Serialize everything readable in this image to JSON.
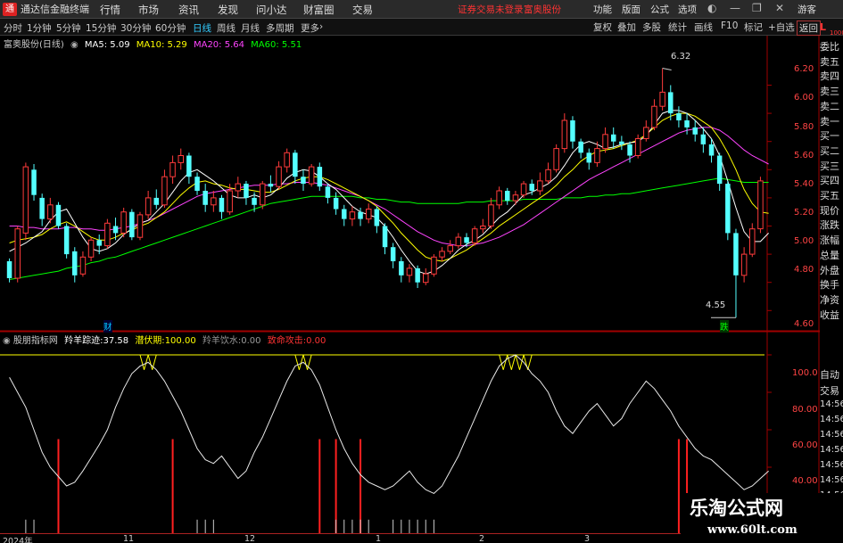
{
  "app": {
    "title": "通达信金融终端",
    "logo": "通"
  },
  "menus": [
    "行情",
    "市场",
    "资讯",
    "发现",
    "问小达",
    "财富圈",
    "交易"
  ],
  "notice": {
    "login": "证券交易未登录",
    "stock": "富奥股份"
  },
  "right_menus": [
    "功能",
    "版面",
    "公式",
    "选项"
  ],
  "guest": "游客",
  "periods": [
    "分时",
    "1分钟",
    "5分钟",
    "15分钟",
    "30分钟",
    "60分钟",
    "日线",
    "周线",
    "月线",
    "多周期",
    "更多"
  ],
  "active_period": "日线",
  "tools": [
    "复权",
    "叠加",
    "多股",
    "统计",
    "画线",
    "F10",
    "标记",
    "+自选",
    "返回"
  ],
  "stock_line": {
    "name": "富奥股份(日线)",
    "ma5": "MA5: 5.09",
    "ma10": "MA10: 5.29",
    "ma20": "MA20: 5.64",
    "ma60": "MA60: 5.51"
  },
  "price_axis": [
    "6.20",
    "6.00",
    "5.80",
    "5.60",
    "5.40",
    "5.20",
    "5.00",
    "4.80",
    "4.60"
  ],
  "high_label": "6.32",
  "low_label": "4.55",
  "marks": {
    "cai": "财",
    "die": "跌"
  },
  "indicator": {
    "name": "股朋指标网",
    "a_label": "羚羊踪迹:",
    "a_val": "37.58",
    "b_label": "潜伏期:",
    "b_val": "100.00",
    "c_label": "羚羊饮水:",
    "c_val": "0.00",
    "d_label": "致命攻击:",
    "d_val": "0.00"
  },
  "ind_axis": [
    "100.0",
    "80.00",
    "60.00",
    "40.00"
  ],
  "side_top": {
    "L": "L",
    "code": "1000"
  },
  "side_labels": [
    "委比",
    "卖五",
    "卖四",
    "卖三",
    "卖二",
    "卖一",
    "买一",
    "买二",
    "买三",
    "买四",
    "买五",
    "现价",
    "涨跌",
    "涨幅",
    "总量",
    "外盘",
    "换手",
    "净资",
    "收益"
  ],
  "side_lower": [
    "自动",
    "交易"
  ],
  "side_times": [
    "14:56",
    "14:56",
    "14:56",
    "14:56",
    "14:56",
    "14:56",
    "14:56",
    "14:56",
    "14:56"
  ],
  "dates": [
    "2024年",
    "11",
    "12",
    "1",
    "2",
    "3"
  ],
  "watermark": {
    "title": "乐淘公式网",
    "url": "www.60lt.com"
  },
  "colors": {
    "up": "#ff3b3b",
    "down": "#54ffff",
    "ma5": "#ffffff",
    "ma10": "#ffff00",
    "ma20": "#ff44ff",
    "ma60": "#00ff00",
    "grid": "#a00000"
  },
  "chart_data": {
    "type": "candlestick",
    "ylim": [
      4.45,
      6.45
    ],
    "candles": [
      [
        4.95,
        4.83,
        4.97,
        4.8
      ],
      [
        4.83,
        5.18,
        5.2,
        4.8
      ],
      [
        5.15,
        5.62,
        5.65,
        5.1
      ],
      [
        5.6,
        5.42,
        5.64,
        5.38
      ],
      [
        5.4,
        5.25,
        5.43,
        5.2
      ],
      [
        5.25,
        5.35,
        5.4,
        5.22
      ],
      [
        5.35,
        5.2,
        5.37,
        5.18
      ],
      [
        5.2,
        5.0,
        5.22,
        4.97
      ],
      [
        5.02,
        4.85,
        5.05,
        4.8
      ],
      [
        4.86,
        4.98,
        5.02,
        4.84
      ],
      [
        4.98,
        5.1,
        5.12,
        4.95
      ],
      [
        5.1,
        5.06,
        5.14,
        5.0
      ],
      [
        5.06,
        5.22,
        5.25,
        5.04
      ],
      [
        5.2,
        5.15,
        5.26,
        5.1
      ],
      [
        5.15,
        5.3,
        5.33,
        5.12
      ],
      [
        5.3,
        5.12,
        5.32,
        5.1
      ],
      [
        5.12,
        5.28,
        5.3,
        5.1
      ],
      [
        5.28,
        5.4,
        5.45,
        5.25
      ],
      [
        5.4,
        5.35,
        5.46,
        5.32
      ],
      [
        5.35,
        5.55,
        5.6,
        5.33
      ],
      [
        5.55,
        5.65,
        5.7,
        5.5
      ],
      [
        5.65,
        5.7,
        5.75,
        5.6
      ],
      [
        5.7,
        5.55,
        5.72,
        5.5
      ],
      [
        5.55,
        5.45,
        5.58,
        5.42
      ],
      [
        5.45,
        5.35,
        5.5,
        5.3
      ],
      [
        5.35,
        5.4,
        5.45,
        5.3
      ],
      [
        5.4,
        5.3,
        5.42,
        5.25
      ],
      [
        5.3,
        5.45,
        5.5,
        5.28
      ],
      [
        5.45,
        5.5,
        5.55,
        5.4
      ],
      [
        5.5,
        5.4,
        5.52,
        5.35
      ],
      [
        5.4,
        5.35,
        5.44,
        5.3
      ],
      [
        5.35,
        5.5,
        5.52,
        5.32
      ],
      [
        5.5,
        5.48,
        5.56,
        5.44
      ],
      [
        5.48,
        5.62,
        5.66,
        5.46
      ],
      [
        5.62,
        5.72,
        5.75,
        5.58
      ],
      [
        5.72,
        5.55,
        5.74,
        5.5
      ],
      [
        5.55,
        5.5,
        5.6,
        5.45
      ],
      [
        5.5,
        5.62,
        5.64,
        5.48
      ],
      [
        5.62,
        5.48,
        5.65,
        5.45
      ],
      [
        5.48,
        5.4,
        5.5,
        5.36
      ],
      [
        5.4,
        5.32,
        5.44,
        5.28
      ],
      [
        5.32,
        5.25,
        5.35,
        5.2
      ],
      [
        5.25,
        5.3,
        5.34,
        5.2
      ],
      [
        5.3,
        5.25,
        5.33,
        5.2
      ],
      [
        5.25,
        5.32,
        5.36,
        5.22
      ],
      [
        5.32,
        5.2,
        5.34,
        5.15
      ],
      [
        5.2,
        5.05,
        5.22,
        5.0
      ],
      [
        5.05,
        4.95,
        5.08,
        4.9
      ],
      [
        4.95,
        4.85,
        4.98,
        4.8
      ],
      [
        4.85,
        4.9,
        4.93,
        4.8
      ],
      [
        4.9,
        4.8,
        4.92,
        4.76
      ],
      [
        4.8,
        4.86,
        4.9,
        4.78
      ],
      [
        4.86,
        4.98,
        5.0,
        4.84
      ],
      [
        4.98,
        5.02,
        5.05,
        4.95
      ],
      [
        5.02,
        5.06,
        5.1,
        5.0
      ],
      [
        5.06,
        5.12,
        5.15,
        5.04
      ],
      [
        5.12,
        5.08,
        5.15,
        5.05
      ],
      [
        5.08,
        5.18,
        5.2,
        5.06
      ],
      [
        5.18,
        5.2,
        5.25,
        5.15
      ],
      [
        5.2,
        5.35,
        5.4,
        5.18
      ],
      [
        5.35,
        5.45,
        5.48,
        5.32
      ],
      [
        5.45,
        5.38,
        5.47,
        5.35
      ],
      [
        5.38,
        5.42,
        5.45,
        5.35
      ],
      [
        5.42,
        5.5,
        5.52,
        5.4
      ],
      [
        5.5,
        5.45,
        5.53,
        5.42
      ],
      [
        5.45,
        5.52,
        5.58,
        5.42
      ],
      [
        5.52,
        5.6,
        5.65,
        5.5
      ],
      [
        5.6,
        5.75,
        5.78,
        5.58
      ],
      [
        5.75,
        5.95,
        6.0,
        5.72
      ],
      [
        5.95,
        5.8,
        5.98,
        5.75
      ],
      [
        5.8,
        5.72,
        5.82,
        5.68
      ],
      [
        5.72,
        5.65,
        5.75,
        5.6
      ],
      [
        5.65,
        5.75,
        5.8,
        5.62
      ],
      [
        5.75,
        5.85,
        5.9,
        5.72
      ],
      [
        5.85,
        5.8,
        5.9,
        5.75
      ],
      [
        5.8,
        5.78,
        5.84,
        5.74
      ],
      [
        5.78,
        5.7,
        5.8,
        5.65
      ],
      [
        5.7,
        5.82,
        5.85,
        5.68
      ],
      [
        5.82,
        5.9,
        5.95,
        5.8
      ],
      [
        5.9,
        6.05,
        6.1,
        5.88
      ],
      [
        6.05,
        6.15,
        6.32,
        6.02
      ],
      [
        6.15,
        6.0,
        6.2,
        5.95
      ],
      [
        6.0,
        5.95,
        6.05,
        5.9
      ],
      [
        5.95,
        5.9,
        6.0,
        5.85
      ],
      [
        5.9,
        5.85,
        5.95,
        5.8
      ],
      [
        5.85,
        5.78,
        5.9,
        5.72
      ],
      [
        5.78,
        5.7,
        5.82,
        5.65
      ],
      [
        5.7,
        5.5,
        5.72,
        5.45
      ],
      [
        5.5,
        5.15,
        5.52,
        5.1
      ],
      [
        5.15,
        4.85,
        5.18,
        4.55
      ],
      [
        4.85,
        5.0,
        5.05,
        4.8
      ],
      [
        5.0,
        5.18,
        5.22,
        4.98
      ],
      [
        5.18,
        5.52,
        5.55,
        5.15
      ]
    ],
    "ma5": [
      5.02,
      5.05,
      5.08,
      5.12,
      5.16,
      5.24,
      5.3,
      5.32,
      5.22,
      5.12,
      5.04,
      5.02,
      5.04,
      5.08,
      5.14,
      5.18,
      5.22,
      5.24,
      5.3,
      5.36,
      5.44,
      5.52,
      5.58,
      5.6,
      5.56,
      5.52,
      5.47,
      5.42,
      5.4,
      5.4,
      5.42,
      5.4,
      5.42,
      5.47,
      5.54,
      5.58,
      5.6,
      5.59,
      5.55,
      5.5,
      5.46,
      5.4,
      5.34,
      5.3,
      5.28,
      5.26,
      5.2,
      5.12,
      5.03,
      4.95,
      4.88,
      4.86,
      4.88,
      4.92,
      4.97,
      5.03,
      5.07,
      5.1,
      5.14,
      5.2,
      5.26,
      5.3,
      5.36,
      5.42,
      5.44,
      5.47,
      5.5,
      5.55,
      5.63,
      5.72,
      5.78,
      5.8,
      5.78,
      5.75,
      5.76,
      5.78,
      5.79,
      5.8,
      5.84,
      5.92,
      6.0,
      6.02,
      6.02,
      6.0,
      5.95,
      5.89,
      5.82,
      5.7,
      5.52,
      5.33,
      5.16,
      5.09,
      5.09,
      5.15
    ],
    "ma10": [
      5.08,
      5.1,
      5.11,
      5.12,
      5.14,
      5.18,
      5.21,
      5.23,
      5.2,
      5.16,
      5.12,
      5.1,
      5.1,
      5.12,
      5.15,
      5.17,
      5.2,
      5.22,
      5.26,
      5.3,
      5.36,
      5.42,
      5.47,
      5.51,
      5.52,
      5.5,
      5.49,
      5.47,
      5.46,
      5.46,
      5.45,
      5.44,
      5.44,
      5.46,
      5.49,
      5.52,
      5.54,
      5.55,
      5.55,
      5.53,
      5.5,
      5.47,
      5.44,
      5.41,
      5.38,
      5.34,
      5.28,
      5.22,
      5.15,
      5.09,
      5.03,
      4.98,
      4.96,
      4.95,
      4.97,
      5.0,
      5.03,
      5.07,
      5.11,
      5.15,
      5.2,
      5.24,
      5.28,
      5.32,
      5.36,
      5.4,
      5.44,
      5.49,
      5.55,
      5.6,
      5.66,
      5.7,
      5.73,
      5.74,
      5.75,
      5.77,
      5.79,
      5.81,
      5.85,
      5.9,
      5.95,
      5.98,
      6.0,
      6.0,
      5.98,
      5.94,
      5.9,
      5.82,
      5.72,
      5.6,
      5.46,
      5.36,
      5.3,
      5.29
    ],
    "ma20": [
      5.2,
      5.2,
      5.19,
      5.19,
      5.18,
      5.18,
      5.18,
      5.19,
      5.19,
      5.18,
      5.18,
      5.17,
      5.17,
      5.18,
      5.19,
      5.2,
      5.22,
      5.24,
      5.26,
      5.29,
      5.32,
      5.35,
      5.38,
      5.41,
      5.43,
      5.44,
      5.45,
      5.46,
      5.47,
      5.48,
      5.49,
      5.49,
      5.49,
      5.5,
      5.5,
      5.51,
      5.51,
      5.51,
      5.5,
      5.49,
      5.47,
      5.45,
      5.43,
      5.41,
      5.38,
      5.35,
      5.32,
      5.28,
      5.24,
      5.2,
      5.16,
      5.13,
      5.1,
      5.08,
      5.07,
      5.06,
      5.06,
      5.07,
      5.08,
      5.1,
      5.12,
      5.15,
      5.18,
      5.21,
      5.25,
      5.29,
      5.33,
      5.37,
      5.41,
      5.45,
      5.49,
      5.53,
      5.56,
      5.59,
      5.62,
      5.65,
      5.68,
      5.71,
      5.74,
      5.77,
      5.8,
      5.83,
      5.86,
      5.88,
      5.89,
      5.9,
      5.9,
      5.88,
      5.84,
      5.79,
      5.74,
      5.7,
      5.67,
      5.64
    ],
    "ma60": [
      4.82,
      4.83,
      4.84,
      4.85,
      4.86,
      4.87,
      4.88,
      4.9,
      4.91,
      4.92,
      4.94,
      4.95,
      4.97,
      4.98,
      5.0,
      5.02,
      5.04,
      5.06,
      5.08,
      5.1,
      5.12,
      5.14,
      5.16,
      5.18,
      5.2,
      5.22,
      5.24,
      5.26,
      5.28,
      5.3,
      5.32,
      5.34,
      5.36,
      5.37,
      5.38,
      5.39,
      5.4,
      5.41,
      5.41,
      5.41,
      5.41,
      5.41,
      5.41,
      5.4,
      5.4,
      5.39,
      5.39,
      5.38,
      5.37,
      5.37,
      5.36,
      5.36,
      5.36,
      5.36,
      5.36,
      5.36,
      5.37,
      5.37,
      5.37,
      5.38,
      5.38,
      5.38,
      5.38,
      5.39,
      5.39,
      5.39,
      5.39,
      5.39,
      5.4,
      5.4,
      5.4,
      5.41,
      5.41,
      5.42,
      5.42,
      5.43,
      5.43,
      5.44,
      5.45,
      5.46,
      5.47,
      5.48,
      5.49,
      5.5,
      5.51,
      5.52,
      5.53,
      5.54,
      5.53,
      5.52,
      5.51,
      5.51,
      5.51,
      5.51
    ],
    "indicator_series": [
      88,
      80,
      72,
      60,
      48,
      40,
      35,
      30,
      32,
      38,
      45,
      52,
      60,
      72,
      82,
      90,
      94,
      96,
      92,
      86,
      78,
      70,
      60,
      50,
      44,
      42,
      46,
      40,
      34,
      38,
      48,
      56,
      66,
      76,
      86,
      94,
      96,
      92,
      84,
      72,
      60,
      50,
      42,
      36,
      32,
      30,
      28,
      30,
      34,
      38,
      32,
      28,
      26,
      30,
      38,
      46,
      56,
      66,
      76,
      86,
      94,
      98,
      100,
      96,
      90,
      86,
      80,
      70,
      62,
      58,
      64,
      70,
      74,
      68,
      62,
      66,
      74,
      80,
      86,
      82,
      76,
      70,
      62,
      56,
      50,
      46,
      44,
      40,
      36,
      32,
      28,
      30,
      34,
      38
    ],
    "red_bars": [
      6,
      20,
      38,
      40,
      43,
      82,
      83
    ],
    "white_bar_groups": [
      [
        2,
        3
      ],
      [
        23,
        24,
        25
      ],
      [
        40,
        41,
        42,
        43,
        44
      ],
      [
        47,
        48,
        49,
        50,
        51,
        52
      ]
    ]
  }
}
